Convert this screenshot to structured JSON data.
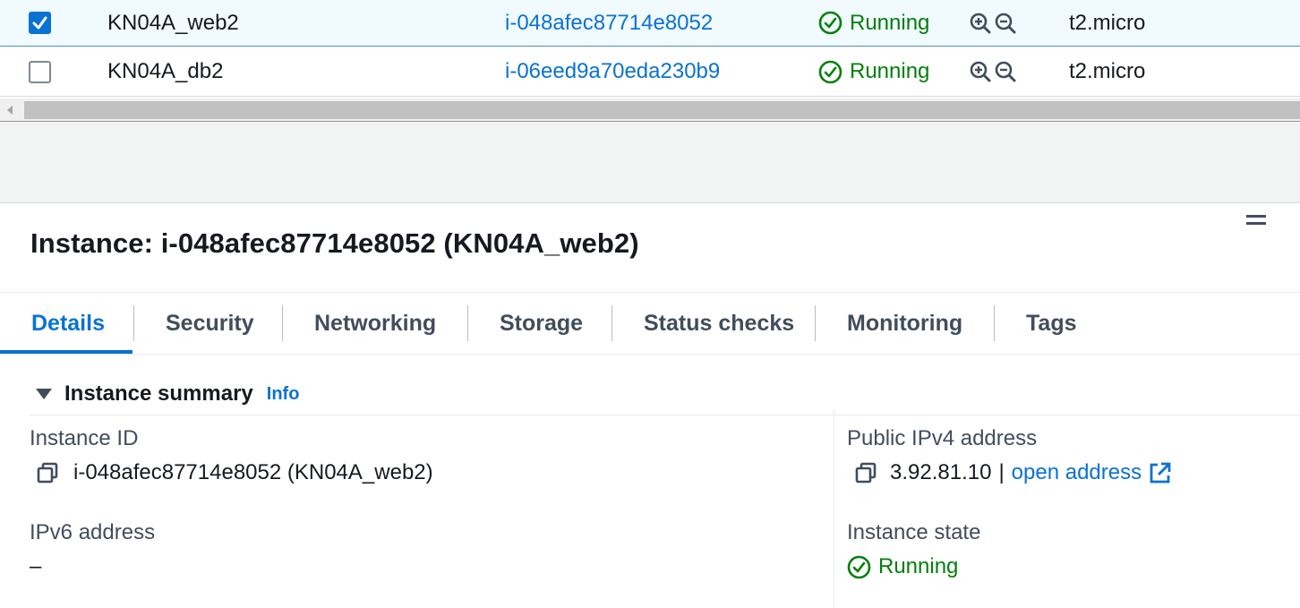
{
  "instances": [
    {
      "selected": true,
      "name": "KN04A_web2",
      "id": "i-048afec87714e8052",
      "state": "Running",
      "type": "t2.micro"
    },
    {
      "selected": false,
      "name": "KN04A_db2",
      "id": "i-06eed9a70eda230b9",
      "state": "Running",
      "type": "t2.micro"
    }
  ],
  "details": {
    "title": "Instance: i-048afec87714e8052 (KN04A_web2)",
    "tabs": [
      "Details",
      "Security",
      "Networking",
      "Storage",
      "Status checks",
      "Monitoring",
      "Tags"
    ],
    "active_tab": "Details",
    "section": {
      "title": "Instance summary",
      "info_label": "Info"
    },
    "fields": {
      "instance_id_label": "Instance ID",
      "instance_id_value": "i-048afec87714e8052 (KN04A_web2)",
      "public_ipv4_label": "Public IPv4 address",
      "public_ipv4_value": "3.92.81.10",
      "separator": "|",
      "open_address_label": "open address",
      "ipv6_label": "IPv6 address",
      "ipv6_value": "–",
      "instance_state_label": "Instance state",
      "instance_state_value": "Running"
    }
  },
  "colors": {
    "accent": "#0972d3",
    "success": "#037f0c",
    "text": "#16191f",
    "muted": "#414d5c"
  },
  "icons": [
    "check-icon",
    "status-running-icon",
    "zoom-in-icon",
    "zoom-out-icon",
    "copy-icon",
    "external-link-icon",
    "caret-down-icon"
  ]
}
